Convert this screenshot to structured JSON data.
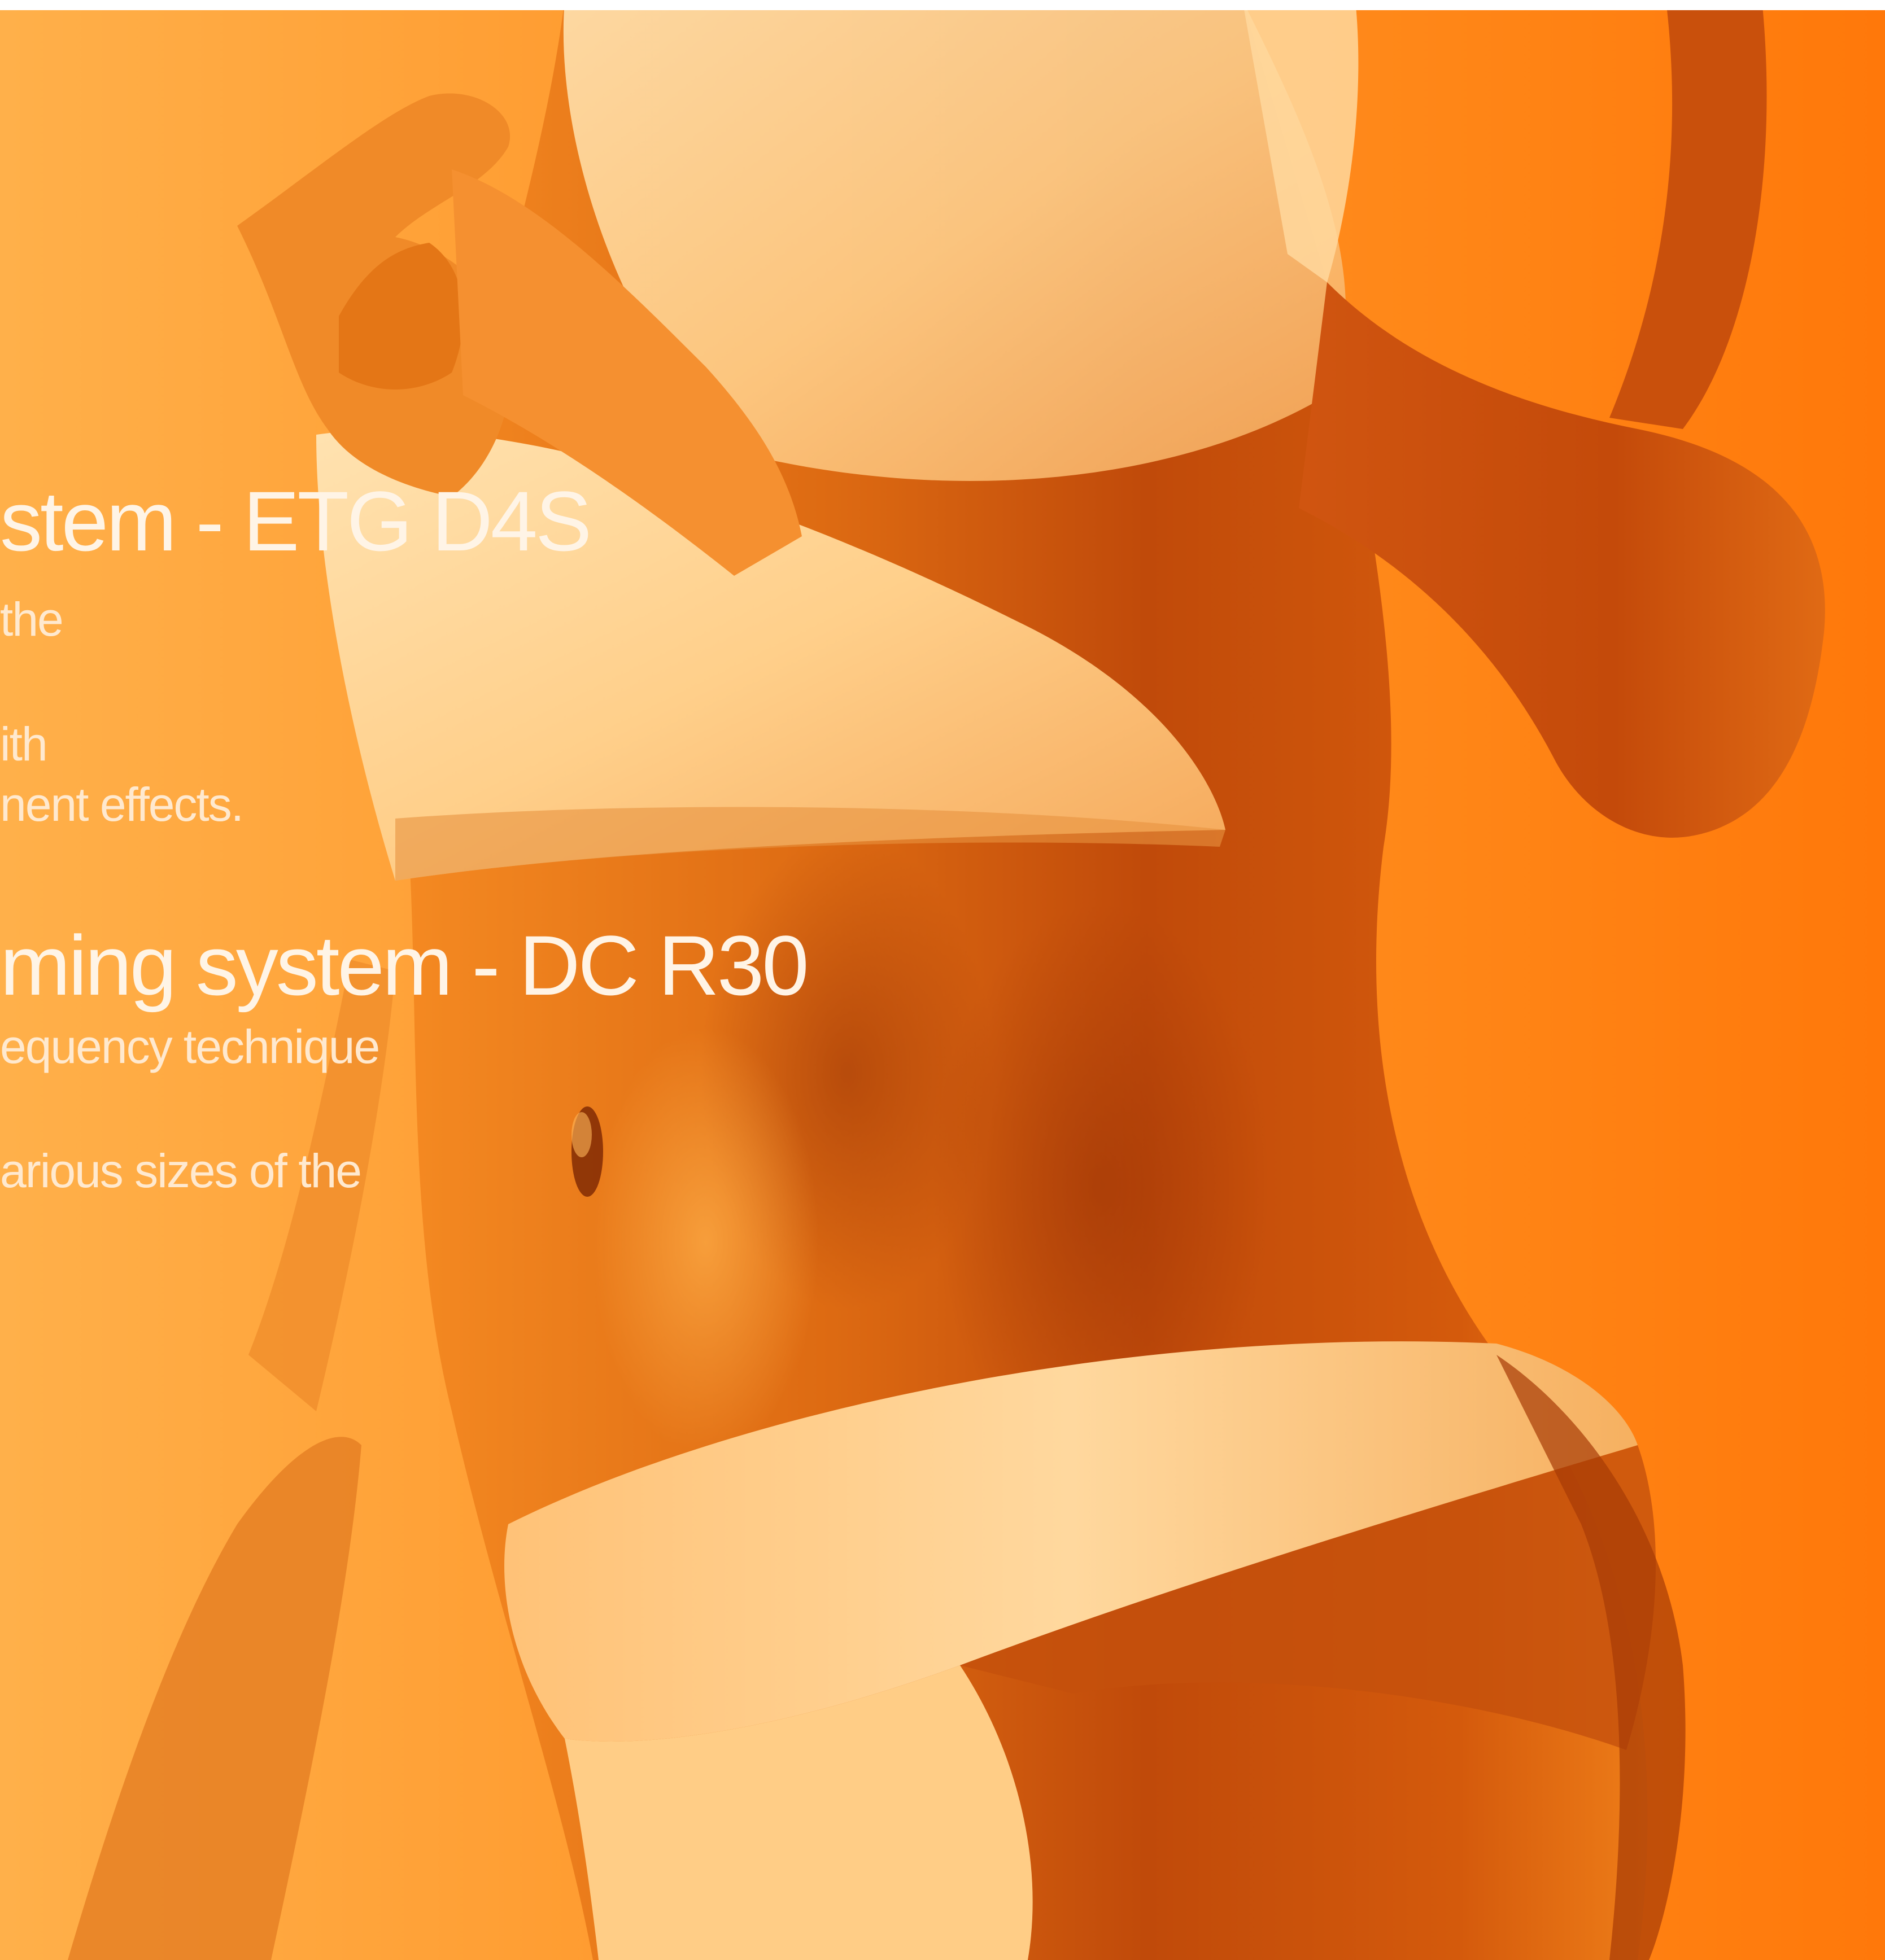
{
  "colors": {
    "background_light": "#ffb24a",
    "background_mid": "#ff8a1c",
    "background_right": "#ff7a0a",
    "skin_shadow": "#b33c07",
    "skin_mid": "#d9620f",
    "fabric": "#ffd79a",
    "text": "#fff4e6"
  },
  "captions": {
    "heading_1": "stem - ETG D4S",
    "line_1": "the",
    "line_2": "ith",
    "line_3": "nent effects.",
    "heading_2": "ming system - DC R30",
    "line_4": "equency technique",
    "line_5": "arious sizes of the"
  }
}
